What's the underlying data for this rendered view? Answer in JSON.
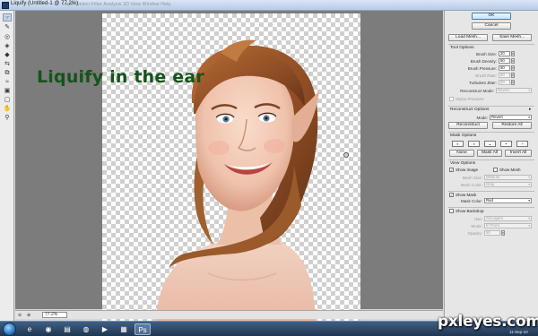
{
  "window": {
    "title": "Liquify (Untitled-1 @ 77.2%)",
    "menu_strip": "Layer  Select  Filter  Analysis  3D  View  Window  Help"
  },
  "canvas": {
    "caption": "Liquify in the ear",
    "zoom_value": "77.2%",
    "zoom_minus": "⊖",
    "zoom_plus": "⊕"
  },
  "tools": [
    {
      "name": "forward-warp-tool",
      "glyph": "☞",
      "active": true
    },
    {
      "name": "reconstruct-tool",
      "glyph": "✎"
    },
    {
      "name": "twirl-tool",
      "glyph": "◎"
    },
    {
      "name": "pucker-tool",
      "glyph": "◈"
    },
    {
      "name": "bloat-tool",
      "glyph": "◆"
    },
    {
      "name": "push-left-tool",
      "glyph": "⇆"
    },
    {
      "name": "mirror-tool",
      "glyph": "⧉"
    },
    {
      "name": "turbulence-tool",
      "glyph": "≈"
    },
    {
      "name": "freeze-mask-tool",
      "glyph": "▣"
    },
    {
      "name": "thaw-mask-tool",
      "glyph": "▢"
    },
    {
      "name": "hand-tool",
      "glyph": "✋"
    },
    {
      "name": "zoom-tool",
      "glyph": "⚲"
    }
  ],
  "panel": {
    "ok_label": "OK",
    "cancel_label": "Cancel",
    "load_mesh_label": "Load Mesh...",
    "save_mesh_label": "Save Mesh...",
    "tool_options_title": "Tool Options",
    "brush_size_label": "Brush Size:",
    "brush_size_value": "20",
    "brush_density_label": "Brush Density:",
    "brush_density_value": "50",
    "brush_pressure_label": "Brush Pressure:",
    "brush_pressure_value": "50",
    "brush_rate_label": "Brush Rate:",
    "brush_rate_value": "80",
    "turbulent_jitter_label": "Turbulent Jitter:",
    "turbulent_jitter_value": "50",
    "reconstruct_mode_label": "Reconstruct Mode:",
    "reconstruct_mode_value": "Revert",
    "stylus_pressure_label": "Stylus Pressure",
    "reconstruct_options_title": "Reconstruct Options",
    "mode_label": "Mode:",
    "mode_value": "Revert",
    "reconstruct_button": "Reconstruct",
    "restore_all_button": "Restore All",
    "mask_options_title": "Mask Options",
    "none_button": "None",
    "mask_all_button": "Mask All",
    "invert_all_button": "Invert All",
    "view_options_title": "View Options",
    "show_image_label": "Show Image",
    "show_mesh_label": "Show Mesh",
    "mesh_size_label": "Mesh Size:",
    "mesh_size_value": "Medium",
    "mesh_color_label": "Mesh Color:",
    "mesh_color_value": "Gray",
    "show_mask_label": "Show Mask",
    "mask_color_label": "Mask Color:",
    "mask_color_value": "Red",
    "show_backdrop_label": "Show Backdrop",
    "use_label": "Use:",
    "use_value": "All Layers",
    "backdrop_mode_label": "Mode:",
    "backdrop_mode_value": "In Front",
    "opacity_label": "Opacity:",
    "opacity_value": "50"
  },
  "taskbar": {
    "date": "11-Sep-10",
    "watermark": "pxleyes.com"
  },
  "colors": {
    "caption": "#14541a",
    "canvas_bg": "#7c7c7c",
    "panel_bg": "#e6e6e6",
    "taskbar": "#1f3550"
  }
}
